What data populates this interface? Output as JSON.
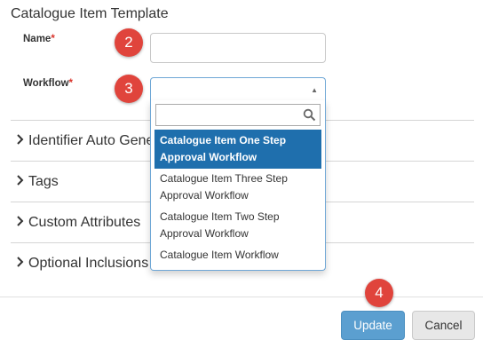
{
  "form": {
    "title": "Catalogue Item Template"
  },
  "fields": {
    "name": {
      "label": "Name",
      "required_mark": "*",
      "value": ""
    },
    "workflow": {
      "label": "Workflow",
      "required_mark": "*",
      "value": ""
    }
  },
  "steps": {
    "name_step": "2",
    "workflow_step": "3",
    "update_step": "4"
  },
  "sections": [
    {
      "label": "Identifier Auto Generation"
    },
    {
      "label": "Tags"
    },
    {
      "label": "Custom Attributes"
    },
    {
      "label": "Optional Inclusions"
    }
  ],
  "workflow_dropdown": {
    "search_value": "",
    "options": [
      {
        "label": "Catalogue Item One Step Approval Workflow",
        "selected": true
      },
      {
        "label": "Catalogue Item Three Step Approval Workflow",
        "selected": false
      },
      {
        "label": "Catalogue Item Two Step Approval Workflow",
        "selected": false
      },
      {
        "label": "Catalogue Item Workflow",
        "selected": false
      }
    ]
  },
  "buttons": {
    "update": "Update",
    "cancel": "Cancel"
  },
  "colors": {
    "accent": "#1f6fad",
    "badge": "#e0443c",
    "required": "#d9342b",
    "update_button": "#5b9fd0"
  },
  "icons": {
    "search": "search-icon",
    "expand": "chevron-right-icon",
    "dropdown": "caret-up-icon"
  }
}
